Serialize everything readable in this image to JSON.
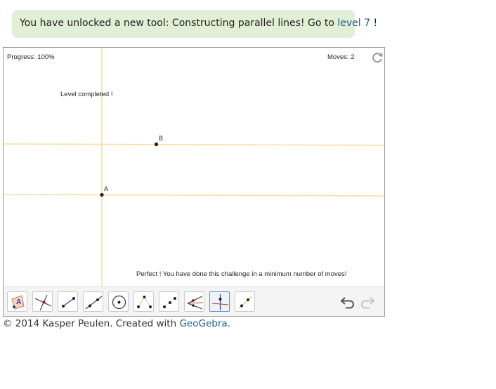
{
  "banner": {
    "prefix": "You have unlocked a new tool: Constructing parallel lines! Go to ",
    "link_label": "level 7",
    "suffix": " !"
  },
  "applet": {
    "progress_label": "Progress: 100%",
    "moves_label": "Moves: 2",
    "level_completed": "Level completed !",
    "success_message": "Perfect ! You have done this challenge in a minimum number of moves!",
    "points": [
      {
        "label": "A"
      },
      {
        "label": "B"
      }
    ],
    "line_color": "#f7dfa3",
    "point_color": "#222222"
  },
  "toolbar": {
    "tools": [
      {
        "name": "move-tool-icon"
      },
      {
        "name": "intersect-tool-icon"
      },
      {
        "name": "segment-tool-icon"
      },
      {
        "name": "line-tool-icon"
      },
      {
        "name": "circle-tool-icon"
      },
      {
        "name": "midpoint-tool-icon"
      },
      {
        "name": "parallel-points-tool-icon"
      },
      {
        "name": "angle-bisector-tool-icon"
      },
      {
        "name": "perpendicular-line-tool-icon",
        "selected": true
      },
      {
        "name": "parallel-line-tool-icon"
      }
    ],
    "accent_color": "#6b8cc7"
  },
  "footer": {
    "prefix": "© 2014 Kasper Peulen. Created with ",
    "link_label": "GeoGebra",
    "suffix": "."
  }
}
